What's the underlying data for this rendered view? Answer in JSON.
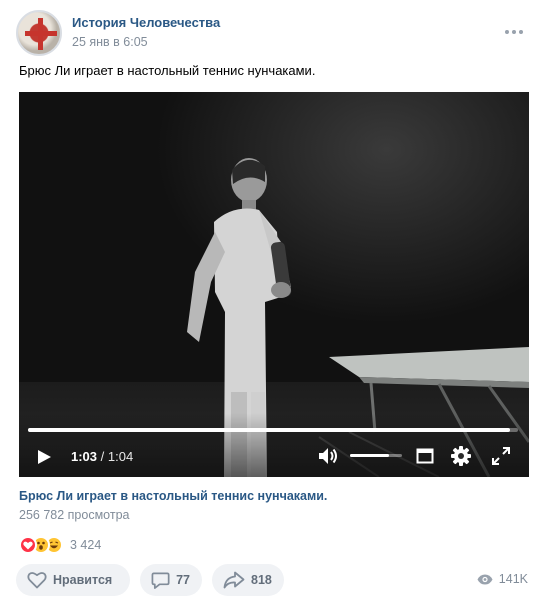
{
  "post": {
    "author": "История Человечества",
    "date": "25 янв в 6:05",
    "text": "Брюс Ли играет в настольный теннис нунчаками."
  },
  "video": {
    "current_time": "1:03",
    "total_time": "/ 1:04",
    "progress": 0.984,
    "volume": 0.75,
    "title": "Брюс Ли играет в настольный теннис нунчаками.",
    "views": "256 782 просмотра"
  },
  "reactions": {
    "icons": [
      "heart-reaction",
      "wow-reaction",
      "laugh-reaction"
    ],
    "count": "3 424"
  },
  "actions": {
    "like_label": "Нравится",
    "comments_count": "77",
    "shares_count": "818",
    "views_count": "141K"
  },
  "colors": {
    "link": "#2a5885",
    "secondary": "#818c99",
    "button_bg": "#f0f2f5",
    "button_text": "#626d7a",
    "heart": "#ff3347"
  }
}
